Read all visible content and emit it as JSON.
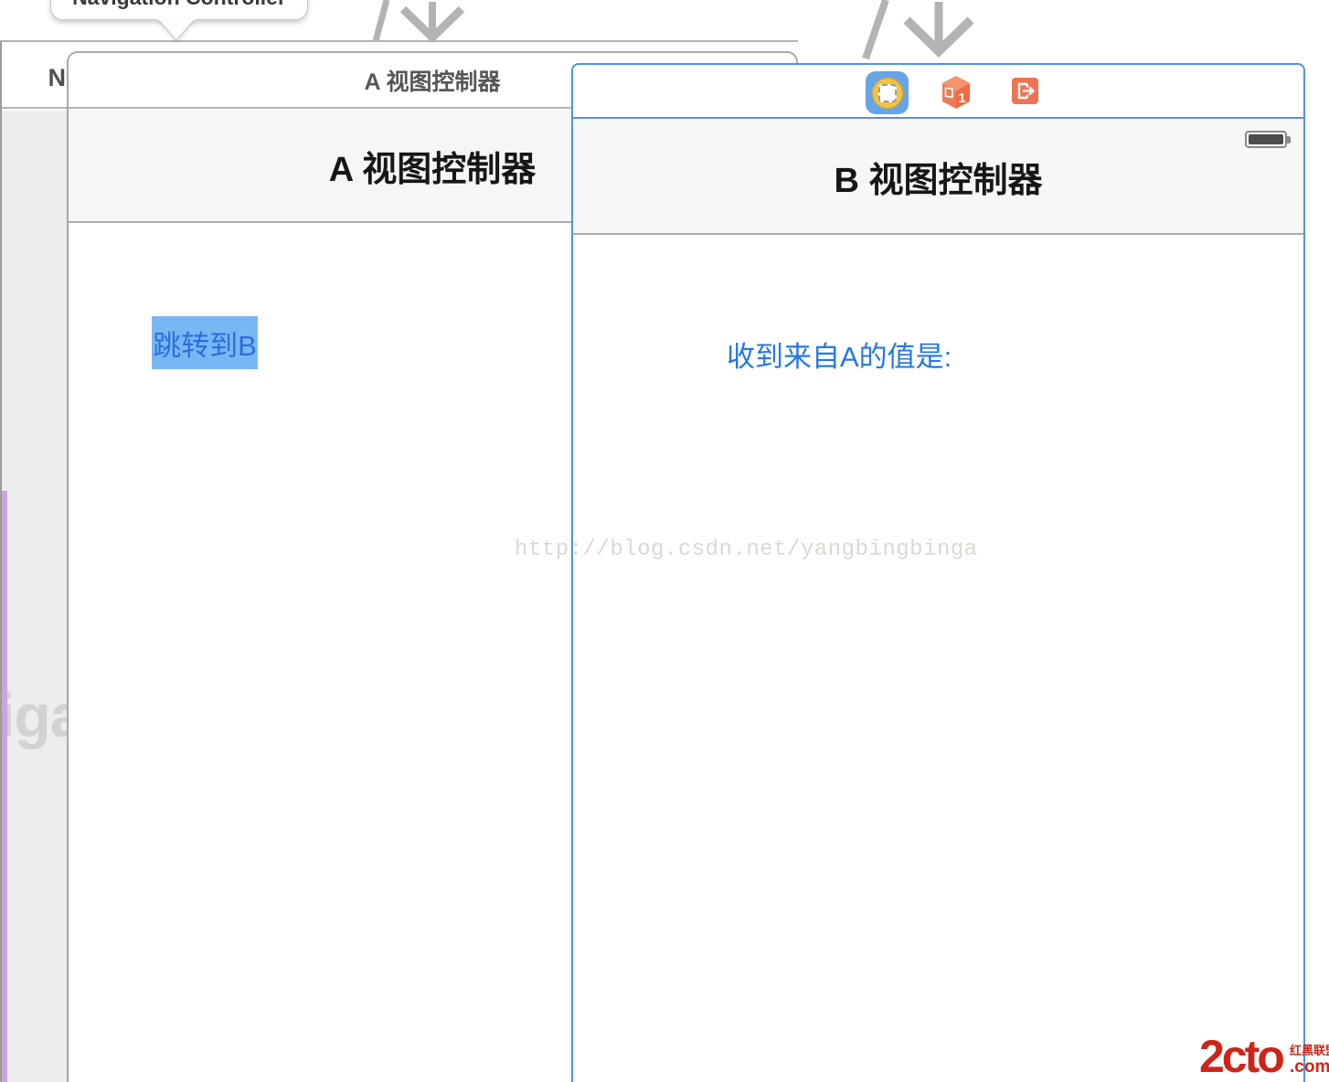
{
  "tooltip": {
    "label": "Navigation Controller"
  },
  "nav_scene": {
    "title_fragment": "N",
    "big_label_fragment": "iga"
  },
  "scene_a": {
    "header_title": "A 视图控制器",
    "nav_title": "A 视图控制器",
    "button_label": "跳转到B"
  },
  "scene_b": {
    "nav_title": "B 视图控制器",
    "value_label": "收到来自A的值是:",
    "first_responder_badge": "1",
    "dock_icons": [
      "view-controller-icon",
      "first-responder-icon",
      "exit-icon"
    ]
  },
  "watermark": {
    "text": "http://blog.csdn.net/yangbingbinga"
  },
  "logo": {
    "brand": "2cto",
    "tld": ".com",
    "alliance": "红黑联盟"
  },
  "colors": {
    "selection_blue": "#4f94dd",
    "button_highlight": "#79b7f2",
    "button_text_blue": "#2b6fdd",
    "label_blue": "#2478e6",
    "icon_orange": "#ee7450",
    "icon_blue": "#68a5e5",
    "icon_gold": "#f2c33c",
    "logo_red": "#d02418",
    "border_gray": "#b3b3b3"
  }
}
